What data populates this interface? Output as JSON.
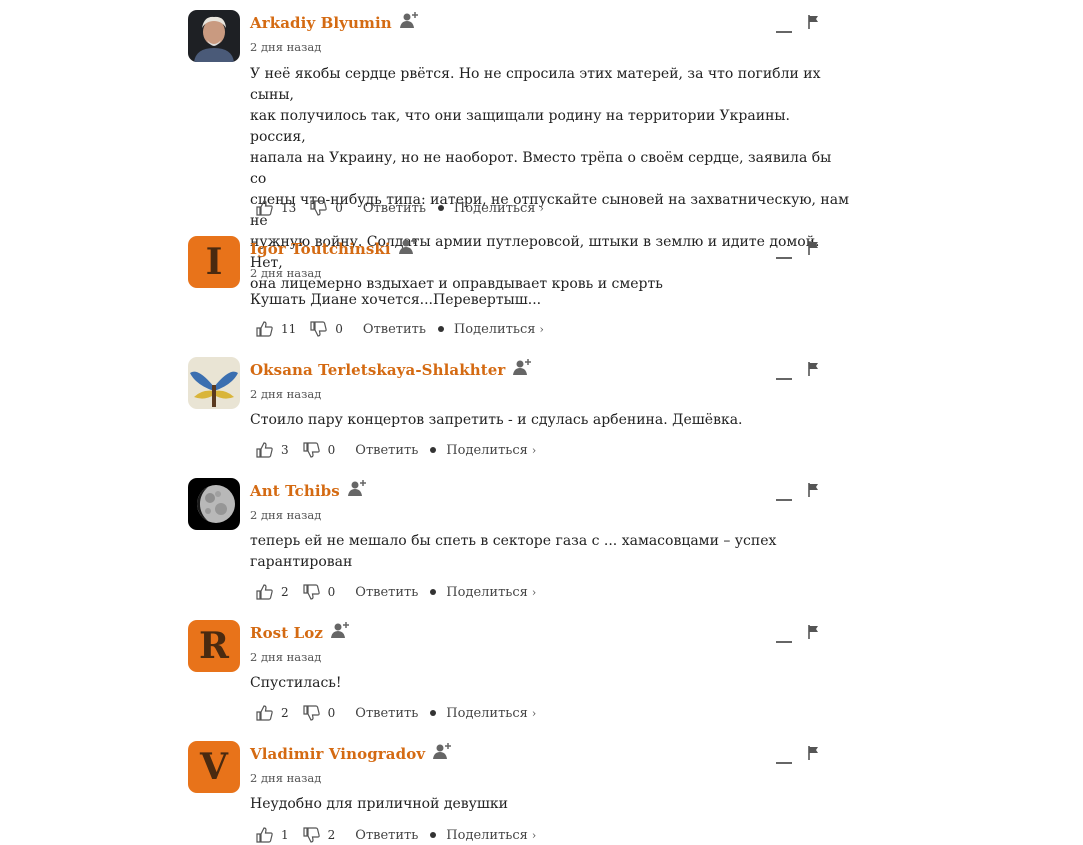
{
  "actions": {
    "reply_label": "Ответить",
    "share_label": "Поделиться",
    "share_chevron": "›"
  },
  "comments": [
    {
      "author": "Arkadiy Blyumin",
      "date": "2 дня назад",
      "text": "У неё якобы сердце рвётся. Но не спросила этих матерей, за что погибли их сыны,\nкак получилось так, что они защищали родину на территории Украины. россия,\nнапала на Украину, но не наоборот. Вместо трёпа о своём сердце, заявила бы со\nсцены что-нибудь типа: иатери, не отпускайте сыновей на захватническую, нам не\nнужную войну. Солдаты армии путлеровсой, штыки в землю и идите домой. Нет,\nона лицемерно вздыхает и оправдывает кровь и смерть",
      "likes": "13",
      "dislikes": "0",
      "avatar": "photo-man"
    },
    {
      "author": "Igor Toutchinski",
      "date": "2 дня назад",
      "text": "Кушать Диане хочется...Перевертыш...",
      "likes": "11",
      "dislikes": "0",
      "avatar_letter": "I"
    },
    {
      "author": "Oksana Terletskaya-Shlakhter",
      "date": "2 дня назад",
      "text": "Стоило пару концертов запретить - и сдулась арбенина. Дешёвка.",
      "likes": "3",
      "dislikes": "0",
      "avatar": "photo-wings"
    },
    {
      "author": "Ant Tchibs",
      "date": "2 дня назад",
      "text": "теперь ей не мешало бы спеть в секторе газа с ... хамасовцами – успех\nгарантирован",
      "likes": "2",
      "dislikes": "0",
      "avatar": "photo-moon"
    },
    {
      "author": "Rost Loz",
      "date": "2 дня назад",
      "text": "Спустилась!",
      "likes": "2",
      "dislikes": "0",
      "avatar_letter": "R"
    },
    {
      "author": "Vladimir Vinogradov",
      "date": "2 дня назад",
      "text": "Неудобно для приличной девушки",
      "likes": "1",
      "dislikes": "2",
      "avatar_letter": "V"
    }
  ],
  "colors": {
    "author": "#d46a12",
    "avatar_letter_bg": "#e8731a"
  }
}
